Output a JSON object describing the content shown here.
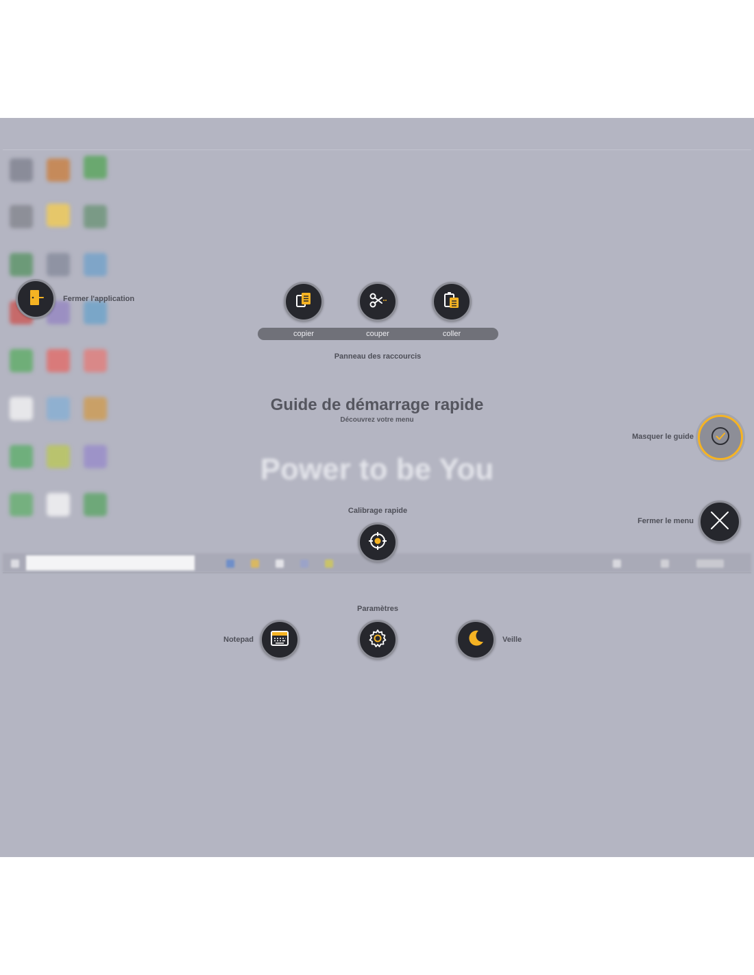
{
  "close_app": {
    "label": "Fermer l'application"
  },
  "shortcuts": {
    "panel_label": "Panneau des raccourcis",
    "copy": "copier",
    "cut": "couper",
    "paste": "coller"
  },
  "guide": {
    "title": "Guide de démarrage rapide",
    "subtitle": "Découvrez votre menu",
    "watermark": "Power to be You"
  },
  "right_menu": {
    "hide_guide": "Masquer le guide",
    "close_menu": "Fermer le menu"
  },
  "calibration": {
    "label": "Calibrage rapide"
  },
  "bottom_menu": {
    "settings": "Paramètres",
    "notepad": "Notepad",
    "sleep": "Veille"
  },
  "colors": {
    "accent": "#f5b323",
    "button_bg": "#26272d",
    "overlay": "#b4b5c2"
  },
  "icons": [
    "exit-door-icon",
    "copy-icon",
    "scissors-icon",
    "paste-icon",
    "check-circle-icon",
    "close-x-icon",
    "target-icon",
    "keyboard-icon",
    "gear-icon",
    "moon-icon"
  ]
}
